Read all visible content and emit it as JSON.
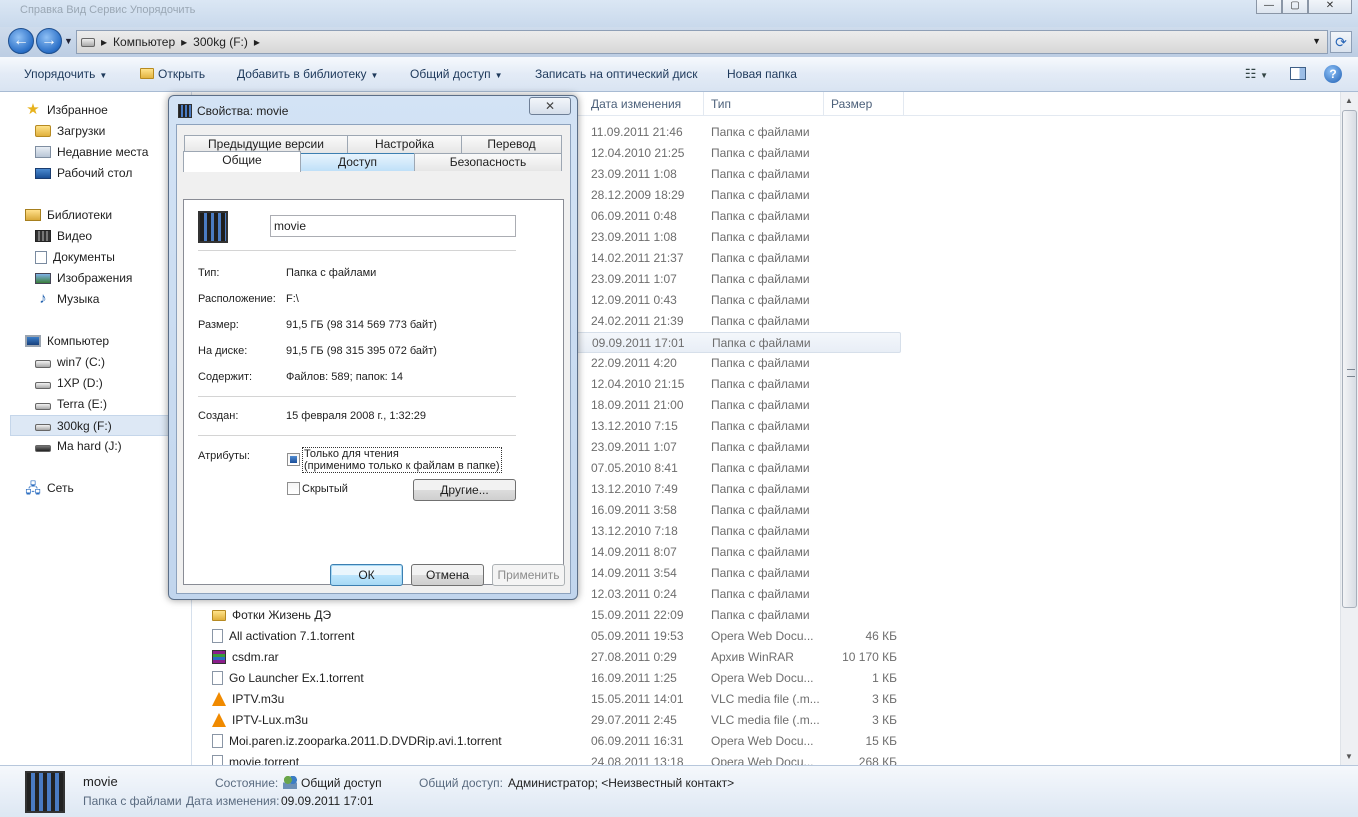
{
  "window": {
    "title_blur": "Справка   Вид   Сервис   Упорядочить",
    "controls": [
      "—",
      "▢",
      "✕"
    ]
  },
  "address": {
    "crumbs": [
      "Компьютер",
      "300kg (F:)"
    ]
  },
  "toolbar": {
    "organize": "Упорядочить",
    "open": "Открыть",
    "add_to_library": "Добавить в библиотеку",
    "share": "Общий доступ",
    "burn": "Записать на оптический диск",
    "new_folder": "Новая папка"
  },
  "nav": {
    "favorites": "Избранное",
    "downloads": "Загрузки",
    "recent": "Недавние места",
    "desktop": "Рабочий стол",
    "libraries": "Библиотеки",
    "video": "Видео",
    "documents": "Документы",
    "images": "Изображения",
    "music": "Музыка",
    "computer": "Компьютер",
    "drive_c": "win7  (C:)",
    "drive_d": "1XP (D:)",
    "drive_e": "Terra (E:)",
    "drive_f": "300kg (F:)",
    "drive_j": "Ma hard (J:)",
    "network": "Сеть"
  },
  "columns": {
    "date": "Дата изменения",
    "type": "Тип",
    "size": "Размер"
  },
  "rows": [
    {
      "name": "",
      "date": "11.09.2011 21:46",
      "type": "Папка с файлами",
      "size": "",
      "icon": "folder"
    },
    {
      "name": "",
      "date": "12.04.2010 21:25",
      "type": "Папка с файлами",
      "size": "",
      "icon": "folder"
    },
    {
      "name": "",
      "date": "23.09.2011 1:08",
      "type": "Папка с файлами",
      "size": "",
      "icon": "folder"
    },
    {
      "name": "",
      "date": "28.12.2009 18:29",
      "type": "Папка с файлами",
      "size": "",
      "icon": "folder"
    },
    {
      "name": "",
      "date": "06.09.2011 0:48",
      "type": "Папка с файлами",
      "size": "",
      "icon": "folder"
    },
    {
      "name": "",
      "date": "23.09.2011 1:08",
      "type": "Папка с файлами",
      "size": "",
      "icon": "folder"
    },
    {
      "name": "",
      "date": "14.02.2011 21:37",
      "type": "Папка с файлами",
      "size": "",
      "icon": "folder"
    },
    {
      "name": "",
      "date": "23.09.2011 1:07",
      "type": "Папка с файлами",
      "size": "",
      "icon": "folder"
    },
    {
      "name": "",
      "date": "12.09.2011 0:43",
      "type": "Папка с файлами",
      "size": "",
      "icon": "folder"
    },
    {
      "name": "",
      "date": "24.02.2011 21:39",
      "type": "Папка с файлами",
      "size": "",
      "icon": "folder"
    },
    {
      "name": "",
      "date": "09.09.2011 17:01",
      "type": "Папка с файлами",
      "size": "",
      "icon": "folder",
      "selected": true
    },
    {
      "name": "",
      "date": "22.09.2011 4:20",
      "type": "Папка с файлами",
      "size": "",
      "icon": "folder"
    },
    {
      "name": "",
      "date": "12.04.2010 21:15",
      "type": "Папка с файлами",
      "size": "",
      "icon": "folder"
    },
    {
      "name": "",
      "date": "18.09.2011 21:00",
      "type": "Папка с файлами",
      "size": "",
      "icon": "folder"
    },
    {
      "name": "",
      "date": "13.12.2010 7:15",
      "type": "Папка с файлами",
      "size": "",
      "icon": "folder"
    },
    {
      "name": "",
      "date": "23.09.2011 1:07",
      "type": "Папка с файлами",
      "size": "",
      "icon": "folder"
    },
    {
      "name": "",
      "date": "07.05.2010 8:41",
      "type": "Папка с файлами",
      "size": "",
      "icon": "folder"
    },
    {
      "name": "",
      "date": "13.12.2010 7:49",
      "type": "Папка с файлами",
      "size": "",
      "icon": "folder"
    },
    {
      "name": "",
      "date": "16.09.2011 3:58",
      "type": "Папка с файлами",
      "size": "",
      "icon": "folder"
    },
    {
      "name": "",
      "date": "13.12.2010 7:18",
      "type": "Папка с файлами",
      "size": "",
      "icon": "folder"
    },
    {
      "name": "",
      "date": "14.09.2011 8:07",
      "type": "Папка с файлами",
      "size": "",
      "icon": "folder"
    },
    {
      "name": "",
      "date": "14.09.2011 3:54",
      "type": "Папка с файлами",
      "size": "",
      "icon": "folder"
    },
    {
      "name": "",
      "date": "12.03.2011 0:24",
      "type": "Папка с файлами",
      "size": "",
      "icon": "folder"
    },
    {
      "name": "Фотки Жизень ДЭ",
      "date": "15.09.2011 22:09",
      "type": "Папка с файлами",
      "size": "",
      "icon": "folder"
    },
    {
      "name": "All activation 7.1.torrent",
      "date": "05.09.2011 19:53",
      "type": "Opera Web Docu...",
      "size": "46 КБ",
      "icon": "doc"
    },
    {
      "name": "csdm.rar",
      "date": "27.08.2011 0:29",
      "type": "Архив WinRAR",
      "size": "10 170 КБ",
      "icon": "rar"
    },
    {
      "name": "Go Launcher Ex.1.torrent",
      "date": "16.09.2011 1:25",
      "type": "Opera Web Docu...",
      "size": "1 КБ",
      "icon": "doc"
    },
    {
      "name": "IPTV.m3u",
      "date": "15.05.2011 14:01",
      "type": "VLC media file (.m...",
      "size": "3 КБ",
      "icon": "vlc"
    },
    {
      "name": "IPTV-Lux.m3u",
      "date": "29.07.2011 2:45",
      "type": "VLC media file (.m...",
      "size": "3 КБ",
      "icon": "vlc"
    },
    {
      "name": "Moi.paren.iz.zooparka.2011.D.DVDRip.avi.1.torrent",
      "date": "06.09.2011 16:31",
      "type": "Opera Web Docu...",
      "size": "15 КБ",
      "icon": "doc"
    },
    {
      "name": "movie.torrent",
      "date": "24.08.2011 13:18",
      "type": "Opera Web Docu...",
      "size": "268 КБ",
      "icon": "doc"
    }
  ],
  "details": {
    "name": "movie",
    "kind": "Папка с файлами",
    "state_label": "Состояние:",
    "state_value": "Общий доступ",
    "modified_label": "Дата изменения:",
    "modified_value": "09.09.2011 17:01",
    "share_label": "Общий доступ:",
    "share_value": "Администратор; <Неизвестный контакт>"
  },
  "dialog": {
    "title": "Свойства: movie",
    "tabs_top": [
      "Предыдущие версии",
      "Настройка",
      "Перевод"
    ],
    "tabs_bottom": [
      "Общие",
      "Доступ",
      "Безопасность"
    ],
    "name_value": "movie",
    "fields": {
      "type_label": "Тип:",
      "type_value": "Папка с файлами",
      "location_label": "Расположение:",
      "location_value": "F:\\",
      "size_label": "Размер:",
      "size_value": "91,5 ГБ (98 314 569 773 байт)",
      "disk_label": "На диске:",
      "disk_value": "91,5 ГБ (98 315 395 072 байт)",
      "contains_label": "Содержит:",
      "contains_value": "Файлов: 589; папок: 14",
      "created_label": "Создан:",
      "created_value": "15 февраля 2008 г., 1:32:29",
      "attributes_label": "Атрибуты:"
    },
    "readonly_line1": "Только для чтения",
    "readonly_line2": "(применимо только к файлам в папке)",
    "hidden": "Скрытый",
    "other_button": "Другие...",
    "ok": "ОК",
    "cancel": "Отмена",
    "apply": "Применить"
  }
}
